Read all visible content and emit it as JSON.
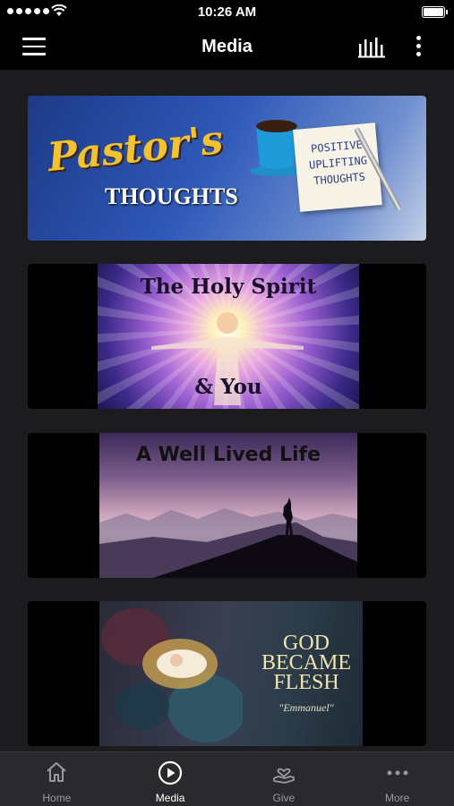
{
  "status_bar": {
    "time": "10:26 AM"
  },
  "nav": {
    "title": "Media"
  },
  "cards": [
    {
      "title_line1": "Pastor's",
      "title_line2": "THOUGHTS",
      "note": "POSITIVE UPLIFTING THOUGHTS"
    },
    {
      "title_line1": "The Holy Spirit",
      "title_line2": "& You"
    },
    {
      "title_line1": "A Well Lived Life"
    },
    {
      "title_line1": "GOD",
      "title_line2": "BECAME",
      "title_line3": "FLESH",
      "subtitle": "\"Emmanuel\""
    }
  ],
  "tabs": [
    {
      "label": "Home",
      "icon": "home-icon"
    },
    {
      "label": "Media",
      "icon": "play-circle-icon",
      "active": true
    },
    {
      "label": "Give",
      "icon": "give-hand-heart-icon"
    },
    {
      "label": "More",
      "icon": "more-horizontal-icon"
    }
  ],
  "colors": {
    "background": "#1c1c1e",
    "bar": "#000000",
    "tabbar": "#2a2a2c",
    "inactive_tab": "#9a9a9e"
  }
}
